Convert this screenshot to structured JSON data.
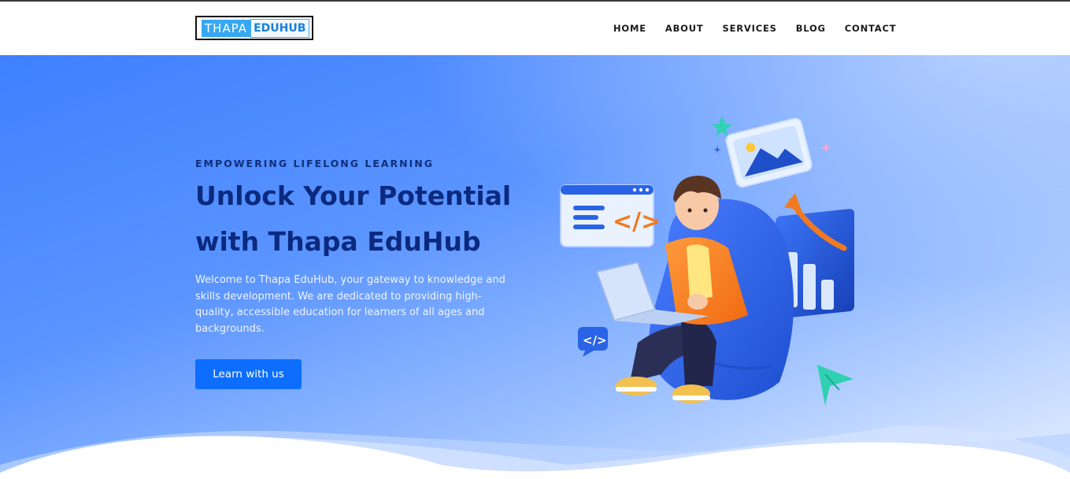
{
  "brand": {
    "logo_part1": "THAPA",
    "logo_part2": "EDUHUB",
    "primary_color": "#37a7f2"
  },
  "nav": {
    "items": [
      {
        "label": "HOME"
      },
      {
        "label": "ABOUT"
      },
      {
        "label": "SERVICES"
      },
      {
        "label": "BLOG"
      },
      {
        "label": "CONTACT"
      }
    ]
  },
  "hero": {
    "eyebrow": "EMPOWERING LIFELONG LEARNING",
    "headline_line1": "Unlock Your Potential",
    "headline_line2": "with Thapa EduHub",
    "description": "Welcome to Thapa EduHub, your gateway to knowledge and skills development. We are dedicated to providing high-quality, accessible education for learners of all ages and backgrounds.",
    "cta_label": "Learn with us",
    "cta_color": "#0d6efd",
    "background_color": "#4d8aff",
    "illustration": "student-with-laptop-illustration"
  }
}
